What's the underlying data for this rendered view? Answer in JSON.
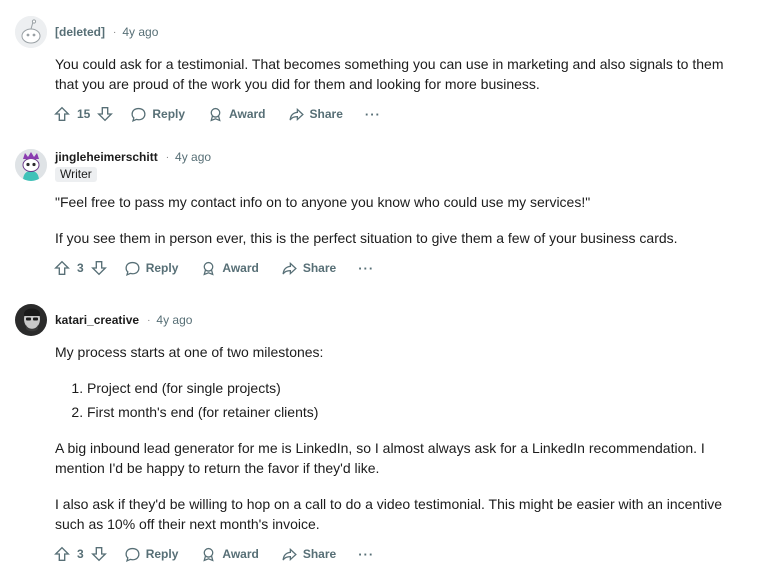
{
  "comments": [
    {
      "author": "[deleted]",
      "age": "4y ago",
      "separator": "·",
      "paragraphs": [
        "You could ask for a testimonial. That becomes something you can use in marketing and also signals to them that you are proud of the work you did for them and looking for more business."
      ],
      "score": "15",
      "actions": {
        "reply": "Reply",
        "award": "Award",
        "share": "Share",
        "more": "···"
      }
    },
    {
      "author": "jingleheimerschitt",
      "age": "4y ago",
      "separator": "·",
      "flair": "Writer",
      "paragraphs": [
        "\"Feel free to pass my contact info on to anyone you know who could use my services!\"",
        "If you see them in person ever, this is the perfect situation to give them a few of your business cards."
      ],
      "score": "3",
      "actions": {
        "reply": "Reply",
        "award": "Award",
        "share": "Share",
        "more": "···"
      }
    },
    {
      "author": "katari_creative",
      "age": "4y ago",
      "separator": "·",
      "intro": "My process starts at one of two milestones:",
      "list": [
        "Project end (for single projects)",
        "First month's end (for retainer clients)"
      ],
      "paragraphs": [
        "A big inbound lead generator for me is LinkedIn, so I almost always ask for a LinkedIn recommendation. I mention I'd be happy to return the favor if they'd like.",
        "I also ask if they'd be willing to hop on a call to do a video testimonial. This might be easier with an incentive such as 10% off their next month's invoice."
      ],
      "score": "3",
      "actions": {
        "reply": "Reply",
        "award": "Award",
        "share": "Share",
        "more": "···"
      }
    }
  ]
}
